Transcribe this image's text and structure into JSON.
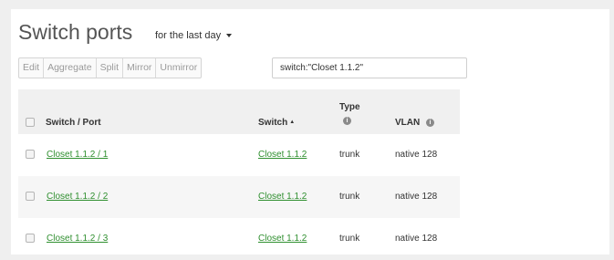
{
  "header": {
    "title": "Switch ports",
    "timespan": "for the last day"
  },
  "toolbar": {
    "buttons": [
      "Edit",
      "Aggregate",
      "Split",
      "Mirror",
      "Unmirror"
    ],
    "search_value": "switch:\"Closet 1.1.2\""
  },
  "table": {
    "columns": {
      "port": "Switch / Port",
      "switch": "Switch",
      "type": "Type",
      "vlan": "VLAN"
    },
    "rows": [
      {
        "port": "Closet 1.1.2 / 1",
        "switch": "Closet 1.1.2",
        "type": "trunk",
        "vlan": "native 128"
      },
      {
        "port": "Closet 1.1.2 / 2",
        "switch": "Closet 1.1.2",
        "type": "trunk",
        "vlan": "native 128"
      },
      {
        "port": "Closet 1.1.2 / 3",
        "switch": "Closet 1.1.2",
        "type": "trunk",
        "vlan": "native 128"
      }
    ]
  },
  "colors": {
    "link": "#2f8f2f",
    "header_bg": "#f0f0f0",
    "alt_row_bg": "#f6f6f6"
  }
}
